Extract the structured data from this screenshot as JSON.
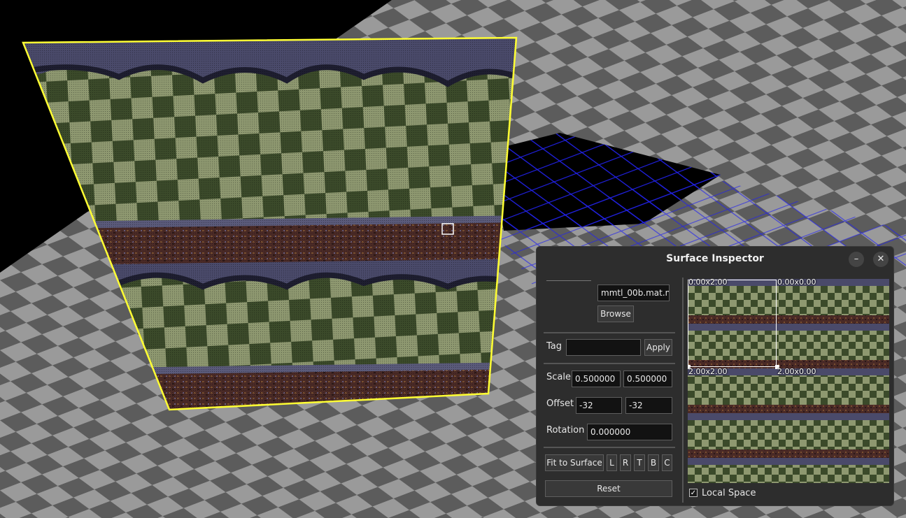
{
  "dialog": {
    "title": "Surface Inspector",
    "minimize_glyph": "–",
    "close_glyph": "✕",
    "material": {
      "value": "mmtl_00b.mat.n",
      "browse_label": "Browse"
    },
    "tag": {
      "label": "Tag",
      "value": "",
      "apply_label": "Apply"
    },
    "scale": {
      "label": "Scale",
      "x": "0.500000",
      "y": "0.500000"
    },
    "offset": {
      "label": "Offset",
      "x": "-32",
      "y": "-32"
    },
    "rotation": {
      "label": "Rotation",
      "value": "0.000000"
    },
    "fit_to_surface_label": "Fit to Surface",
    "align_buttons": [
      "L",
      "R",
      "T",
      "B",
      "C"
    ],
    "reset_label": "Reset",
    "local_space": {
      "label": "Local Space",
      "checked": true,
      "check_glyph": "✓"
    },
    "preview": {
      "uv_labels": [
        "0.00x2.00",
        "0.00x0.00",
        "2.00x2.00",
        "2.00x0.00"
      ]
    }
  },
  "colors": {
    "selection_outline": "#ffff33",
    "grid_line": "#2222ee",
    "floor_light": "#9a9a9a",
    "floor_dark": "#5c5c5c",
    "tex_light": "#8e9870",
    "tex_dark": "#3b4a2a",
    "tex_band": "#4a2a26",
    "tex_trim": "#4a4a6a"
  }
}
